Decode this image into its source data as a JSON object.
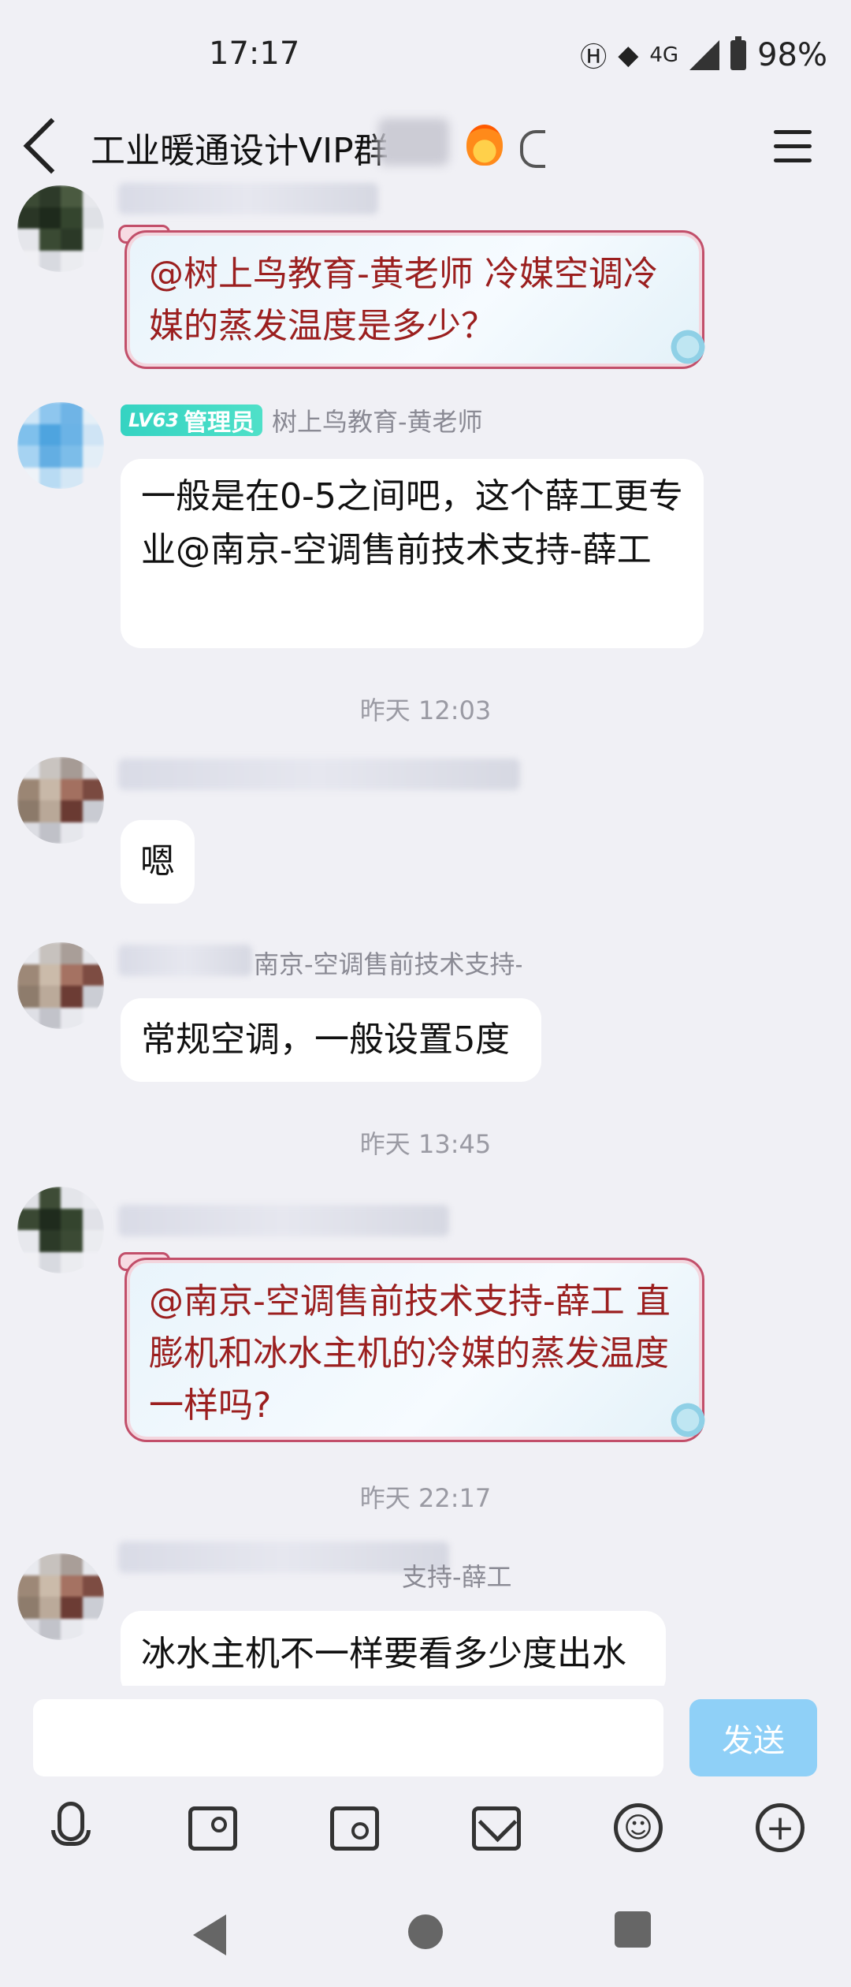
{
  "status": {
    "time": "17:17",
    "network": "4G",
    "battery": "98%"
  },
  "header": {
    "title": "工业暖通设计VIP群"
  },
  "messages": {
    "m1": {
      "text": "@树上鸟教育-黄老师 冷媒空调冷媒的蒸发温度是多少？"
    },
    "m2": {
      "level": "LV63",
      "role": "管理员",
      "sender": "树上鸟教育-黄老师",
      "text": "一般是在0-5之间吧，这个薛工更专业@南京-空调售前技术支持-薛工"
    },
    "ts1": "昨天 12:03",
    "m3": {
      "text": "嗯"
    },
    "m4": {
      "sender": "南京-空调售前技术支持-薛工",
      "text": "常规空调，一般设置5度"
    },
    "ts2": "昨天 13:45",
    "m5": {
      "text": "@南京-空调售前技术支持-薛工 直膨机和冰水主机的冷媒的蒸发温度一样吗?"
    },
    "ts3": "昨天 22:17",
    "m6": {
      "sender": "支持-薛工",
      "text": "冰水主机不一样要看多少度出水"
    }
  },
  "composer": {
    "placeholder": "",
    "send_label": "发送"
  }
}
